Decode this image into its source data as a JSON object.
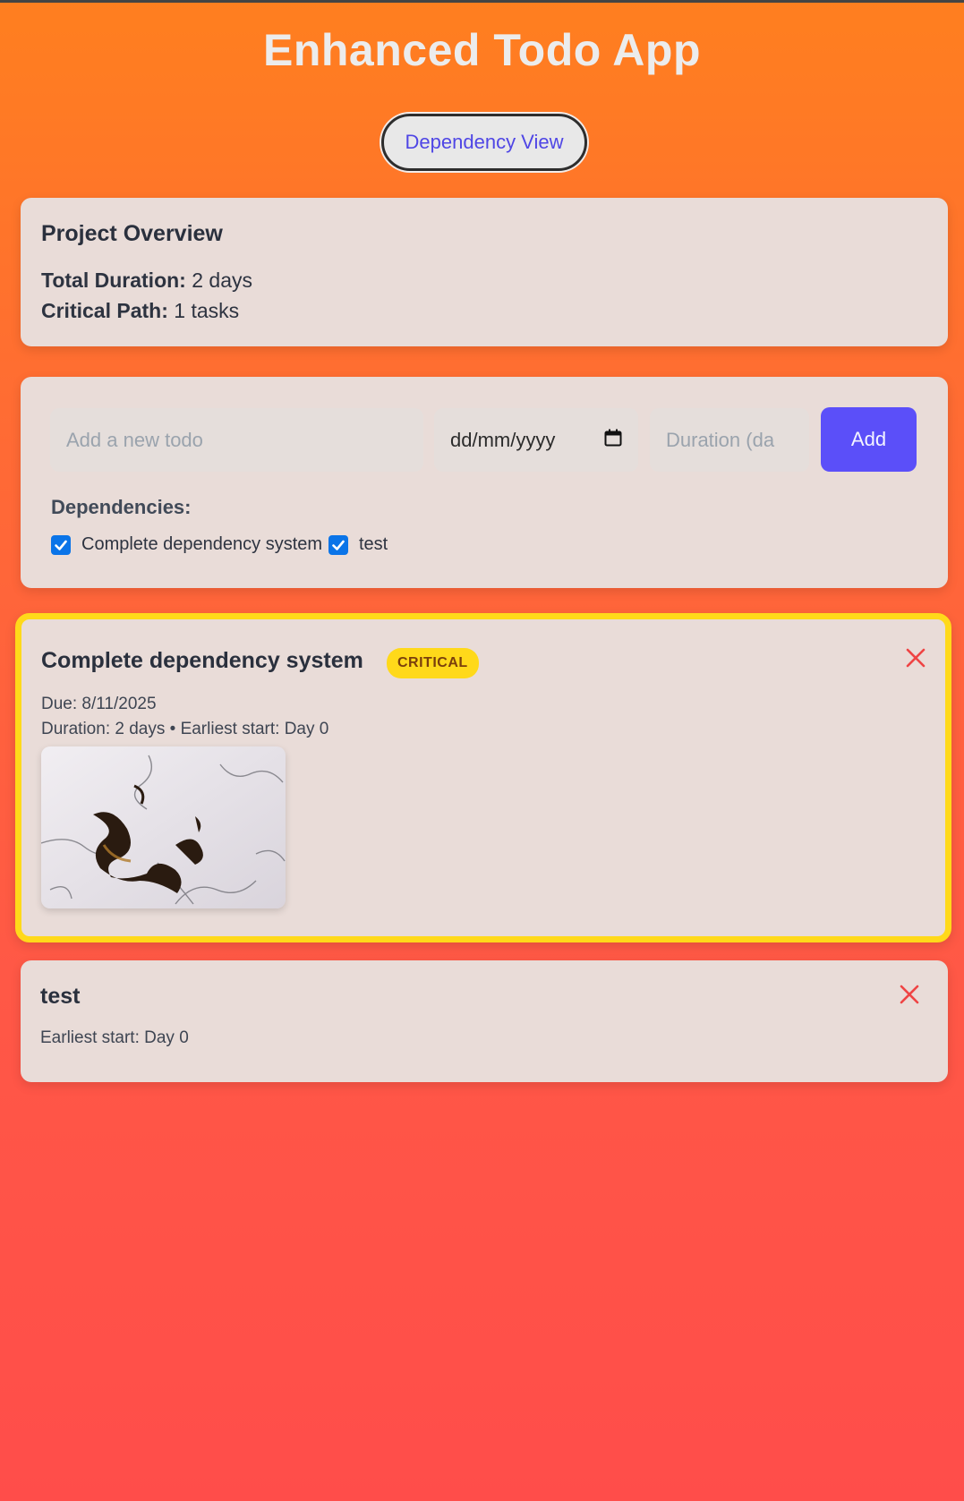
{
  "app": {
    "title": "Enhanced Todo App"
  },
  "view_toggle": {
    "label": "Dependency View"
  },
  "overview": {
    "heading": "Project Overview",
    "total_duration_label": "Total Duration:",
    "total_duration_value": "2 days",
    "critical_path_label": "Critical Path:",
    "critical_path_value": "1 tasks"
  },
  "form": {
    "todo_placeholder": "Add a new todo",
    "date_placeholder": "dd/mm/yyyy",
    "duration_placeholder": "Duration (da",
    "add_label": "Add",
    "dependencies_label": "Dependencies:",
    "dependencies": [
      {
        "label": "Complete dependency system",
        "checked": true
      },
      {
        "label": "test",
        "checked": true
      }
    ]
  },
  "tasks": [
    {
      "title": "Complete dependency system",
      "badge": "CRITICAL",
      "due": "Due: 8/11/2025",
      "details": "Duration: 2 days • Earliest start: Day 0",
      "critical": true
    },
    {
      "title": "test",
      "details": "Earliest start: Day 0",
      "critical": false
    }
  ],
  "colors": {
    "accent": "#5b4ff9",
    "critical_border": "#ffd91a",
    "delete": "#ef4444",
    "checkbox": "#0a74e8"
  },
  "icons": {
    "delete": "close-icon",
    "calendar": "calendar-icon",
    "check": "check-icon"
  }
}
